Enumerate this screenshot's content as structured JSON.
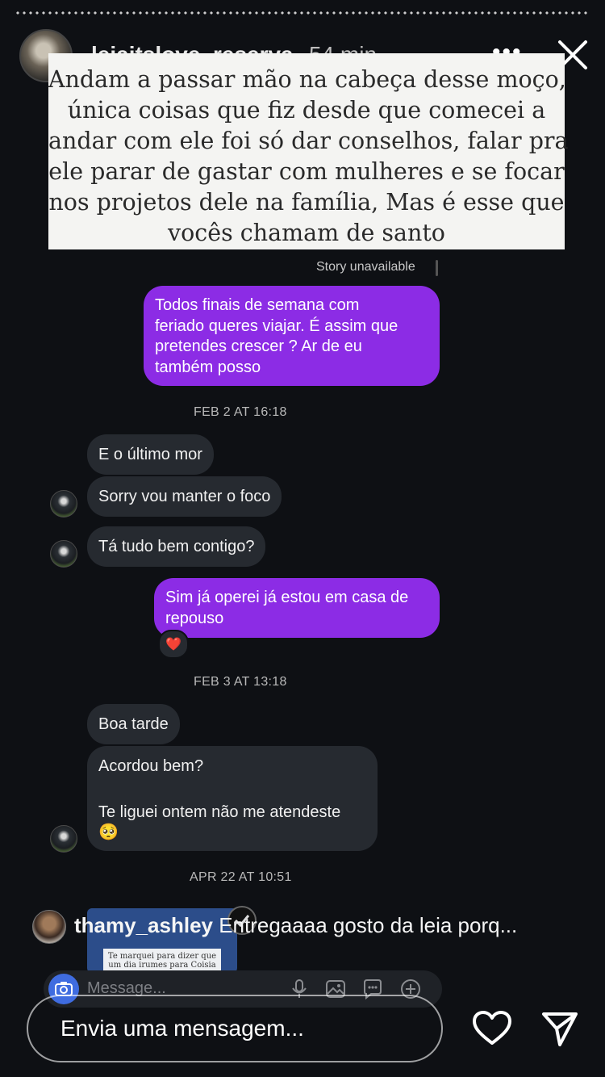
{
  "header": {
    "username": "leiaitslove_reserva",
    "time": "54 min",
    "more": "•••"
  },
  "quote": {
    "lines": [
      "Andam a passar mão na cabeça desse moço,",
      "única coisas que fiz desde que comecei a",
      "andar com ele foi só dar conselhos, falar pra",
      "ele parar de gastar com mulheres e se focar",
      "nos projetos dele na família,   Mas é esse que",
      "vocês chamam de santo"
    ]
  },
  "story_unavailable": "Story unavailable",
  "messages": {
    "out1": [
      "Todos finais de semana com",
      "feriado queres viajar.  É assim que",
      "pretendes crescer ?     Ar de eu",
      "também posso"
    ],
    "ts1": "FEB 2 AT 16:18",
    "in1": "E o último mor",
    "in2": "Sorry vou manter o foco",
    "in3": "Tá tudo bem contigo?",
    "out2": [
      "Sim já operei já estou em casa de",
      "repouso"
    ],
    "reaction": "❤️",
    "ts2": "FEB 3 AT 13:18",
    "in4": "Boa tarde",
    "in5a": "Acordou bem?",
    "in5b": "Te liguei ontem não me atendeste",
    "in5c": "🥺",
    "ts3": "APR 22 AT 10:51"
  },
  "reply_preview": {
    "card_text": "Te marquei para dizer que um dia irumes para Coisia"
  },
  "comment": {
    "user": "thamy_ashley",
    "text": " Entregaaaa gosto da leia porq..."
  },
  "dm_composer": {
    "placeholder": "Message..."
  },
  "reply_bar": {
    "placeholder": "Envia uma mensagem..."
  }
}
